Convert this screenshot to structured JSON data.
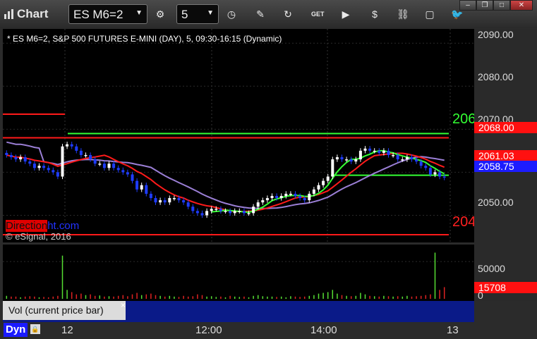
{
  "toolbar": {
    "title": "Chart",
    "symbol": "ES M6=2",
    "interval": "5"
  },
  "chart": {
    "header": "* ES M6=2, S&P 500 FUTURES E-MINI (DAY), 5, 09:30-16:15 (Dynamic)",
    "watermark_direction": "Direction",
    "watermark_site": "ht.com",
    "copyright": "© eSignal, 2016",
    "line_label_green": "206",
    "line_label_red": "204"
  },
  "price_axis": {
    "ticks": [
      "2090.00",
      "2080.00",
      "2070.00",
      "2050.00"
    ],
    "tag_red_high": "2068.00",
    "tag_red_mid": "2061.03",
    "tag_blue_last": "2058.75"
  },
  "volume_axis": {
    "tick_50000": "50000",
    "tick_0": "0",
    "tag_last": "15708"
  },
  "volume_panel": {
    "label": "Vol (current price bar)",
    "close": "×"
  },
  "time_axis": {
    "labels": [
      "12",
      "12:00",
      "14:00",
      "13"
    ],
    "dyn": "Dyn"
  },
  "colors": {
    "bull": "#ffffff",
    "bear": "#1e3cff",
    "ma_red": "#ff1a1a",
    "ma_green": "#33ff33",
    "ma_purple": "#9b7fd6",
    "axis_bg": "#2a2a2a"
  },
  "chart_data": {
    "type": "candlestick",
    "yrange": [
      2045,
      2092
    ],
    "close": [
      2064,
      2063.5,
      2063,
      2063.5,
      2062.5,
      2062,
      2061,
      2061.5,
      2061,
      2060.5,
      2060,
      2059,
      2066,
      2066.5,
      2066,
      2065,
      2064,
      2064,
      2063,
      2062,
      2062,
      2061,
      2062,
      2061,
      2060.5,
      2060,
      2059.5,
      2058,
      2056,
      2057,
      2055,
      2054,
      2053,
      2053.5,
      2053,
      2054,
      2054,
      2053.5,
      2053,
      2052,
      2051,
      2050.5,
      2050,
      2051,
      2051.5,
      2051.5,
      2051,
      2051,
      2050.5,
      2051,
      2051,
      2050.5,
      2050.5,
      2052,
      2053,
      2053.5,
      2054,
      2054.5,
      2054,
      2054.5,
      2055,
      2055,
      2054.5,
      2054,
      2053.5,
      2055,
      2056,
      2057,
      2058,
      2059,
      2063,
      2063.5,
      2063,
      2063,
      2062.5,
      2063,
      2065,
      2065.5,
      2065,
      2065,
      2064.5,
      2065,
      2064,
      2064,
      2063,
      2063,
      2063.5,
      2063,
      2062.5,
      2061.5,
      2061,
      2059.5,
      2060,
      2059,
      2058.75
    ],
    "volume": [
      4000,
      3000,
      3000,
      2000,
      3000,
      3500,
      3000,
      2000,
      2500,
      2000,
      3000,
      4000,
      58000,
      12000,
      9000,
      6000,
      7000,
      5000,
      6000,
      4000,
      4500,
      3000,
      3500,
      3000,
      4000,
      5000,
      3500,
      6000,
      8000,
      5000,
      6000,
      7000,
      5000,
      4000,
      3000,
      4000,
      3000,
      2500,
      4000,
      3000,
      3500,
      6000,
      5000,
      3000,
      3500,
      2500,
      3000,
      2000,
      4000,
      3000,
      2500,
      3000,
      2000,
      4000,
      5000,
      3500,
      3000,
      3000,
      2500,
      3000,
      2000,
      3500,
      3000,
      2500,
      3000,
      4000,
      5000,
      7000,
      8000,
      9000,
      12000,
      7000,
      5000,
      4000,
      3500,
      4000,
      8000,
      6000,
      4000,
      3500,
      3000,
      4000,
      3500,
      3000,
      3500,
      3000,
      4000,
      3000,
      3500,
      4000,
      5000,
      6000,
      62000,
      12000,
      15708
    ]
  }
}
